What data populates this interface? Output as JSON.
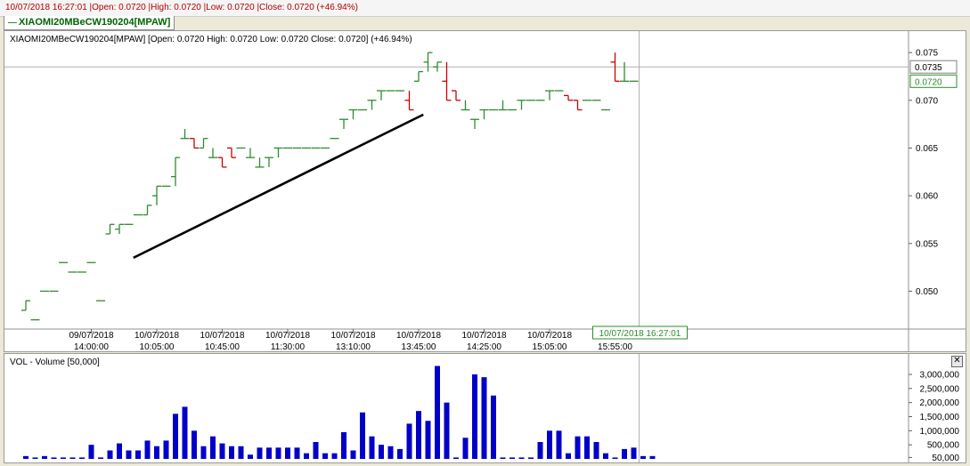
{
  "header": {
    "info": "10/07/2018 16:27:01 |Open: 0.0720 |High: 0.0720 |Low: 0.0720 |Close: 0.0720 (+46.94%)",
    "legend": "XIAOMI20MBeCW190204[MPAW]"
  },
  "colors": {
    "up": "#2e8b2e",
    "down": "#cc0000",
    "volume": "#0000c8",
    "trendline": "#000000",
    "crosshair": "#b0b0b0",
    "current_label": "#2e8b2e"
  },
  "chart_data": [
    {
      "type": "ohlc",
      "title": "XIAOMI20MBeCW190204[MPAW] [Open: 0.0720  High: 0.0720  Low: 0.0720  Close: 0.0720] (+46.94%)",
      "ylim": [
        0.0465,
        0.0765
      ],
      "y_ticks": [
        "0.050",
        "0.055",
        "0.060",
        "0.065",
        "0.070",
        "0.075"
      ],
      "x_ticks": [
        {
          "date": "09/07/2018",
          "time": "14:00:00",
          "bar": 7
        },
        {
          "date": "10/07/2018",
          "time": "10:05:00",
          "bar": 14
        },
        {
          "date": "10/07/2018",
          "time": "10:45:00",
          "bar": 21
        },
        {
          "date": "10/07/2018",
          "time": "11:30:00",
          "bar": 28
        },
        {
          "date": "10/07/2018",
          "time": "13:10:00",
          "bar": 35
        },
        {
          "date": "10/07/2018",
          "time": "13:45:00",
          "bar": 42
        },
        {
          "date": "10/07/2018",
          "time": "14:25:00",
          "bar": 49
        },
        {
          "date": "10/07/2018",
          "time": "15:05:00",
          "bar": 56
        },
        {
          "date": "10/07/2018",
          "time": "15:55:00",
          "bar": 63
        }
      ],
      "open": [
        0.048,
        0.047,
        0.05,
        0.05,
        0.053,
        0.052,
        0.052,
        0.053,
        0.049,
        0.056,
        0.0565,
        0.057,
        0.058,
        0.058,
        0.06,
        0.061,
        0.062,
        0.066,
        0.066,
        0.065,
        0.064,
        0.064,
        0.065,
        0.065,
        0.064,
        0.063,
        0.064,
        0.065,
        0.065,
        0.065,
        0.065,
        0.065,
        0.065,
        0.066,
        0.068,
        0.069,
        0.069,
        0.07,
        0.071,
        0.071,
        0.071,
        0.07,
        0.072,
        0.074,
        0.0735,
        0.072,
        0.071,
        0.069,
        0.068,
        0.069,
        0.069,
        0.069,
        0.069,
        0.07,
        0.07,
        0.07,
        0.071,
        0.071,
        0.0705,
        0.07,
        0.07,
        0.07,
        0.069,
        0.074,
        0.072,
        0.072
      ],
      "high": [
        0.049,
        0.047,
        0.05,
        0.05,
        0.053,
        0.052,
        0.052,
        0.053,
        0.049,
        0.057,
        0.057,
        0.057,
        0.058,
        0.059,
        0.061,
        0.061,
        0.064,
        0.067,
        0.066,
        0.066,
        0.065,
        0.064,
        0.065,
        0.065,
        0.065,
        0.064,
        0.064,
        0.065,
        0.065,
        0.065,
        0.065,
        0.065,
        0.065,
        0.066,
        0.068,
        0.069,
        0.069,
        0.07,
        0.071,
        0.071,
        0.071,
        0.071,
        0.073,
        0.075,
        0.074,
        0.074,
        0.071,
        0.07,
        0.068,
        0.069,
        0.069,
        0.07,
        0.069,
        0.07,
        0.07,
        0.07,
        0.071,
        0.071,
        0.0705,
        0.07,
        0.07,
        0.07,
        0.069,
        0.075,
        0.074,
        0.072
      ],
      "low": [
        0.048,
        0.047,
        0.05,
        0.05,
        0.053,
        0.052,
        0.052,
        0.053,
        0.049,
        0.056,
        0.056,
        0.057,
        0.058,
        0.058,
        0.059,
        0.061,
        0.061,
        0.066,
        0.065,
        0.065,
        0.064,
        0.063,
        0.064,
        0.065,
        0.064,
        0.063,
        0.063,
        0.064,
        0.065,
        0.065,
        0.065,
        0.065,
        0.065,
        0.066,
        0.067,
        0.068,
        0.069,
        0.069,
        0.07,
        0.071,
        0.071,
        0.069,
        0.072,
        0.073,
        0.073,
        0.07,
        0.07,
        0.069,
        0.067,
        0.068,
        0.069,
        0.069,
        0.069,
        0.069,
        0.07,
        0.07,
        0.07,
        0.071,
        0.07,
        0.069,
        0.07,
        0.07,
        0.069,
        0.072,
        0.072,
        0.072
      ],
      "close": [
        0.049,
        0.047,
        0.05,
        0.05,
        0.053,
        0.052,
        0.052,
        0.053,
        0.049,
        0.057,
        0.057,
        0.057,
        0.058,
        0.059,
        0.061,
        0.061,
        0.064,
        0.066,
        0.065,
        0.066,
        0.064,
        0.063,
        0.064,
        0.065,
        0.064,
        0.063,
        0.064,
        0.065,
        0.065,
        0.065,
        0.065,
        0.065,
        0.065,
        0.066,
        0.068,
        0.069,
        0.069,
        0.07,
        0.071,
        0.071,
        0.071,
        0.069,
        0.073,
        0.075,
        0.074,
        0.07,
        0.07,
        0.069,
        0.068,
        0.069,
        0.069,
        0.069,
        0.069,
        0.07,
        0.07,
        0.07,
        0.071,
        0.071,
        0.07,
        0.069,
        0.07,
        0.07,
        0.069,
        0.072,
        0.072,
        0.072
      ],
      "last_price": "0.0720",
      "crosshair_price": "0.0735",
      "crosshair_time": "10/07/2018 16:27:01",
      "trendline": {
        "from": {
          "bar": 11.5,
          "price": 0.0535
        },
        "to": {
          "bar": 42.5,
          "price": 0.0685
        }
      }
    },
    {
      "type": "bar",
      "title": "VOL - Volume [50,000]",
      "ylim": [
        0,
        3600000
      ],
      "y_ticks": [
        "50,000",
        "500,000",
        "1,000,000",
        "1,500,000",
        "2,000,000",
        "2,500,000",
        "3,000,000"
      ],
      "values": [
        100000,
        50000,
        100000,
        50000,
        50000,
        50000,
        50000,
        500000,
        50000,
        300000,
        550000,
        300000,
        300000,
        650000,
        450000,
        650000,
        1600000,
        1850000,
        1000000,
        450000,
        800000,
        550000,
        450000,
        450000,
        150000,
        400000,
        400000,
        400000,
        400000,
        400000,
        200000,
        600000,
        200000,
        200000,
        950000,
        300000,
        1650000,
        800000,
        500000,
        450000,
        350000,
        1250000,
        1700000,
        1350000,
        3300000,
        2000000,
        50000,
        750000,
        3000000,
        2900000,
        2250000,
        50000,
        50000,
        50000,
        50000,
        600000,
        1000000,
        1000000,
        200000,
        800000,
        800000,
        600000,
        200000,
        50000,
        350000,
        400000,
        100000,
        100000
      ]
    }
  ]
}
